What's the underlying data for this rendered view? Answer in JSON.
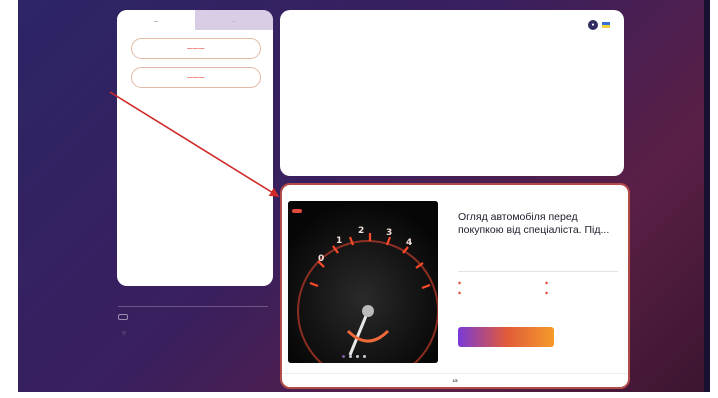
{
  "tabs": [
    {
      "label": "—"
    },
    {
      "label": "—"
    }
  ],
  "actions": [
    {
      "label": "———"
    },
    {
      "label": "———"
    }
  ],
  "top_card": {
    "link": "",
    "line1": "",
    "line2": "",
    "line3": ""
  },
  "info": {
    "title": "",
    "lines": [
      "",
      "",
      ""
    ],
    "badge": "",
    "foot": ""
  },
  "ad": {
    "tag": "",
    "title": "Огляд автомобіля перед покупкою від спеціаліста. Під...",
    "desc": "",
    "features": [
      "",
      "",
      "",
      ""
    ],
    "cta": "",
    "footer_left": "",
    "footer_page": "1/5",
    "footer_right": ""
  },
  "colors": {
    "accent": "#e0362c",
    "bg_start": "#2c2566",
    "bg_end": "#5a1f45"
  },
  "icons": [
    "round-icon",
    "flag-icon",
    "heart-icon",
    "arrow-annotation"
  ]
}
